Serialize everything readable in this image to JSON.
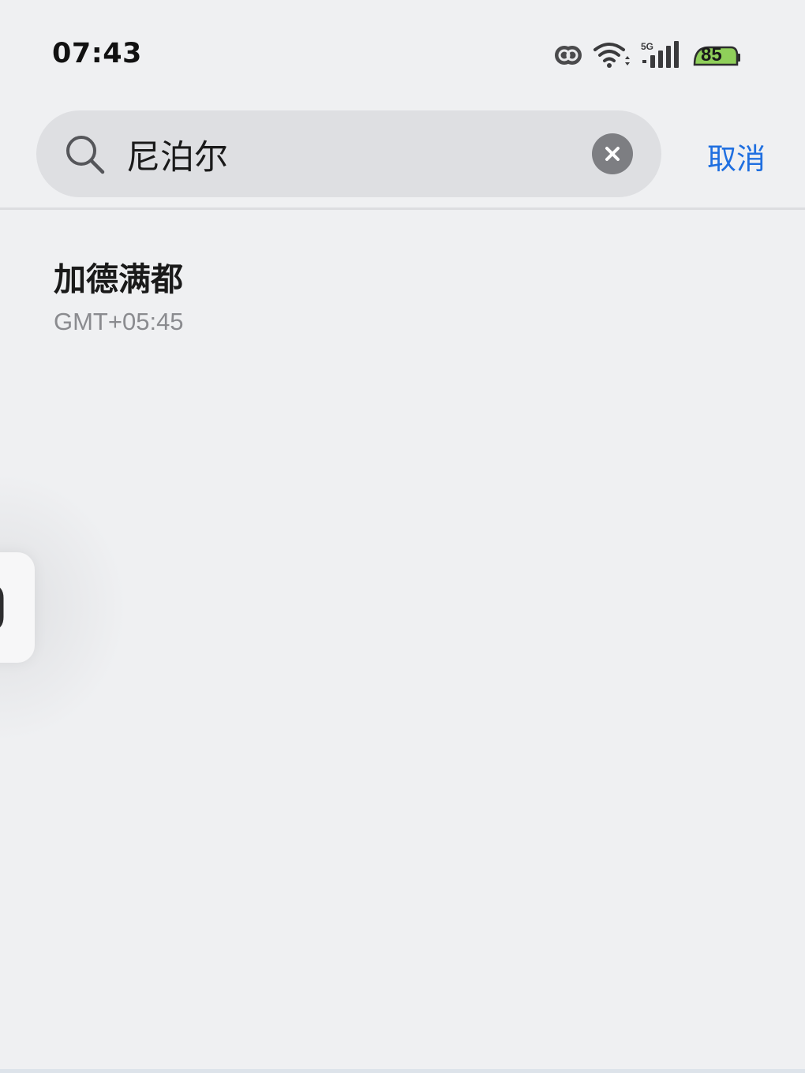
{
  "status_bar": {
    "time": "07:43",
    "network_label": "5G",
    "battery_level": "85",
    "icons": [
      "link-icon",
      "wifi-icon",
      "cellular-signal-icon",
      "battery-icon"
    ]
  },
  "search": {
    "query": "尼泊尔",
    "placeholder": "",
    "cancel_label": "取消"
  },
  "results": [
    {
      "title": "加德满都",
      "subtitle": "GMT+05:45"
    }
  ],
  "colors": {
    "background": "#eff0f2",
    "search_box": "#dedfe2",
    "accent": "#1f6fe0",
    "battery_fill": "#8fcf5a",
    "secondary_text": "#8a8b8f"
  }
}
